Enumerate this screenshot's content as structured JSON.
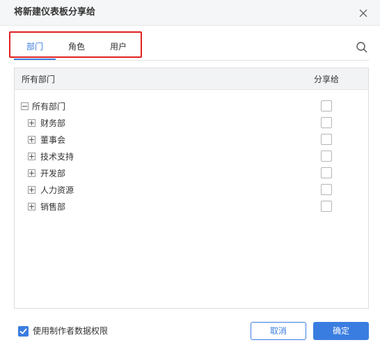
{
  "dialog": {
    "title": "将新建仪表板分享给"
  },
  "tabs": [
    {
      "label": "部门",
      "active": true
    },
    {
      "label": "角色",
      "active": false
    },
    {
      "label": "用户",
      "active": false
    }
  ],
  "table": {
    "header_name": "所有部门",
    "header_share": "分享给",
    "root": {
      "label": "所有部门",
      "expanded": true,
      "checked": false
    },
    "departments": [
      {
        "label": "财务部",
        "expanded": false,
        "checked": false
      },
      {
        "label": "董事会",
        "expanded": false,
        "checked": false
      },
      {
        "label": "技术支持",
        "expanded": false,
        "checked": false
      },
      {
        "label": "开发部",
        "expanded": false,
        "checked": false
      },
      {
        "label": "人力资源",
        "expanded": false,
        "checked": false
      },
      {
        "label": "销售部",
        "expanded": false,
        "checked": false
      }
    ]
  },
  "footer": {
    "use_creator_permission_label": "使用制作者数据权限",
    "use_creator_permission_checked": true,
    "cancel_label": "取消",
    "ok_label": "确定"
  },
  "colors": {
    "accent": "#3a7de0",
    "highlight": "#e02020"
  }
}
